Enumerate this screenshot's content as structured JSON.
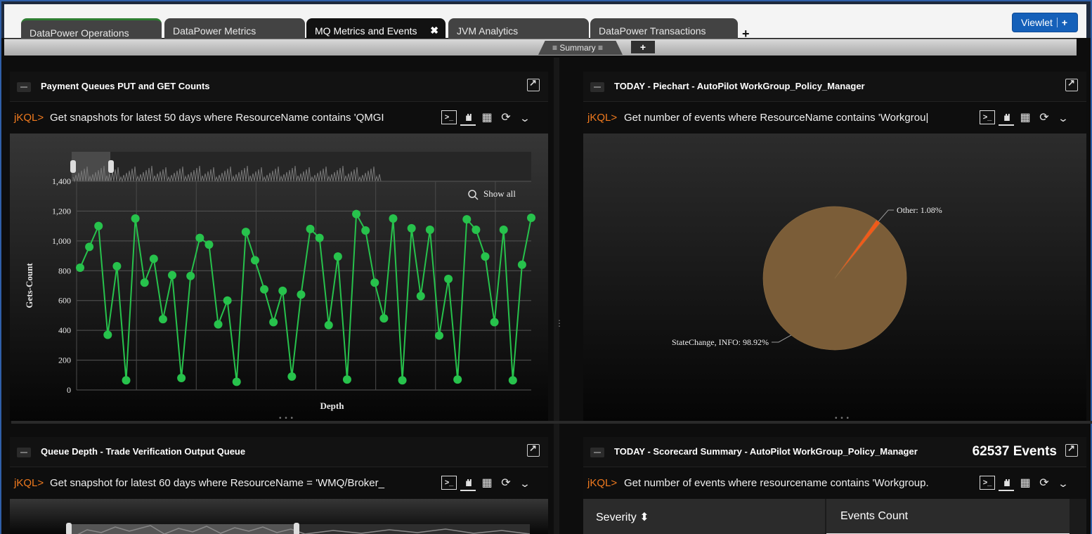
{
  "tabs": [
    {
      "label": "DataPower Operations"
    },
    {
      "label": "DataPower Metrics"
    },
    {
      "label": "MQ Metrics and Events",
      "close": "✖"
    },
    {
      "label": "JVM Analytics"
    },
    {
      "label": "DataPower Transactions"
    }
  ],
  "tab_add": "+",
  "viewlet_button": {
    "label": "Viewlet",
    "plus": "+"
  },
  "summary_tab": {
    "label": "≡ Summary ≡",
    "add": "+"
  },
  "kql_prefix": "jKQL>",
  "colors": {
    "accent": "#1560b9",
    "line_series": "#27c24c",
    "pie_main": "#7b5d38",
    "pie_other": "#f05a1a",
    "kql_prefix": "#f07a1e"
  },
  "panels": {
    "p1": {
      "title": "Payment Queues PUT and GET Counts",
      "query": "Get snapshots for latest 50 days where ResourceName contains 'QMGI"
    },
    "p2": {
      "title": "TODAY - Piechart - AutoPilot WorkGroup_Policy_Manager",
      "query": "Get number of events where ResourceName contains 'Workgrou|"
    },
    "p3": {
      "title": "Queue Depth - Trade Verification Output Queue",
      "query": "Get snapshot for latest 60 days where ResourceName = 'WMQ/Broker_"
    },
    "p4": {
      "title": "TODAY - Scorecard Summary - AutoPilot WorkGroup_Policy_Manager",
      "count": "62537 Events",
      "query": "Get number of events where resourcename contains 'Workgroup.",
      "columns": [
        "Severity ⬍",
        "Events Count"
      ]
    }
  },
  "show_all": "Show all",
  "chart_data": [
    {
      "type": "line",
      "xlabel": "Depth",
      "ylabel": "Gets-Count",
      "ylim": [
        0,
        1400
      ],
      "yticks": [
        "0",
        "200",
        "400",
        "600",
        "800",
        "1,000",
        "1,200",
        "1,400"
      ],
      "grid": true,
      "series": [
        {
          "values": [
            820,
            960,
            1100,
            370,
            830,
            65,
            1150,
            720,
            880,
            475,
            770,
            80,
            765,
            1020,
            975,
            440,
            600,
            55,
            1060,
            870,
            675,
            455,
            665,
            90,
            640,
            1080,
            1020,
            435,
            895,
            70,
            1180,
            1070,
            720,
            480,
            1150,
            65,
            1085,
            630,
            1075,
            365,
            745,
            70,
            1145,
            1075,
            895,
            455,
            1075,
            65,
            840,
            1155
          ]
        }
      ]
    },
    {
      "type": "pie",
      "slices": [
        {
          "label": "StateChange, INFO: 98.92%",
          "value": 98.92
        },
        {
          "label": "Other: 1.08%",
          "value": 1.08
        }
      ]
    }
  ]
}
